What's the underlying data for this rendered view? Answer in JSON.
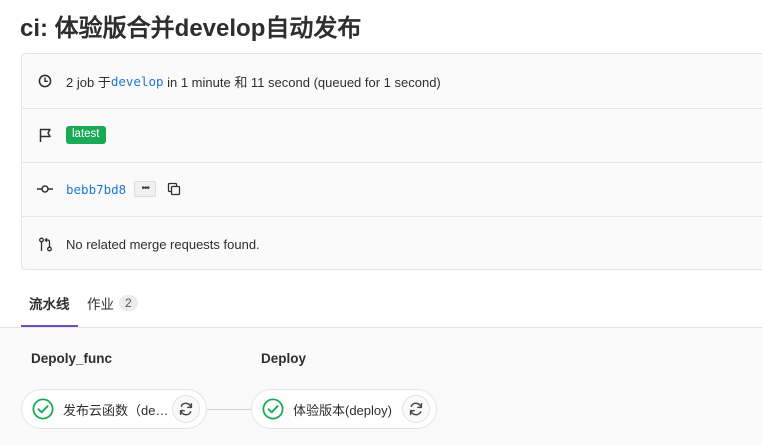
{
  "page": {
    "title": "ci: 体验版合并develop自动发布"
  },
  "info": {
    "summary": {
      "prefix": "2 job 于",
      "branch": "develop",
      "suffix": " in 1 minute 和 11 second (queued for 1 second)"
    },
    "tag": {
      "badge": "latest"
    },
    "commit": {
      "sha": "bebb7bd8",
      "more_label": "•••"
    },
    "merge": {
      "text": "No related merge requests found."
    }
  },
  "tabs": [
    {
      "label": "流水线",
      "active": true
    },
    {
      "label": "作业",
      "count": "2",
      "active": false
    }
  ],
  "pipeline": {
    "stages": [
      {
        "name": "Depoly_func",
        "job": {
          "name": "发布云函数（deploy_func）",
          "status": "success"
        }
      },
      {
        "name": "Deploy",
        "job": {
          "name": "体验版本(deploy)",
          "status": "success"
        }
      }
    ]
  },
  "colors": {
    "success": "#1aaa55",
    "link": "#1f78d1",
    "active_tab": "#6b4fbb"
  }
}
